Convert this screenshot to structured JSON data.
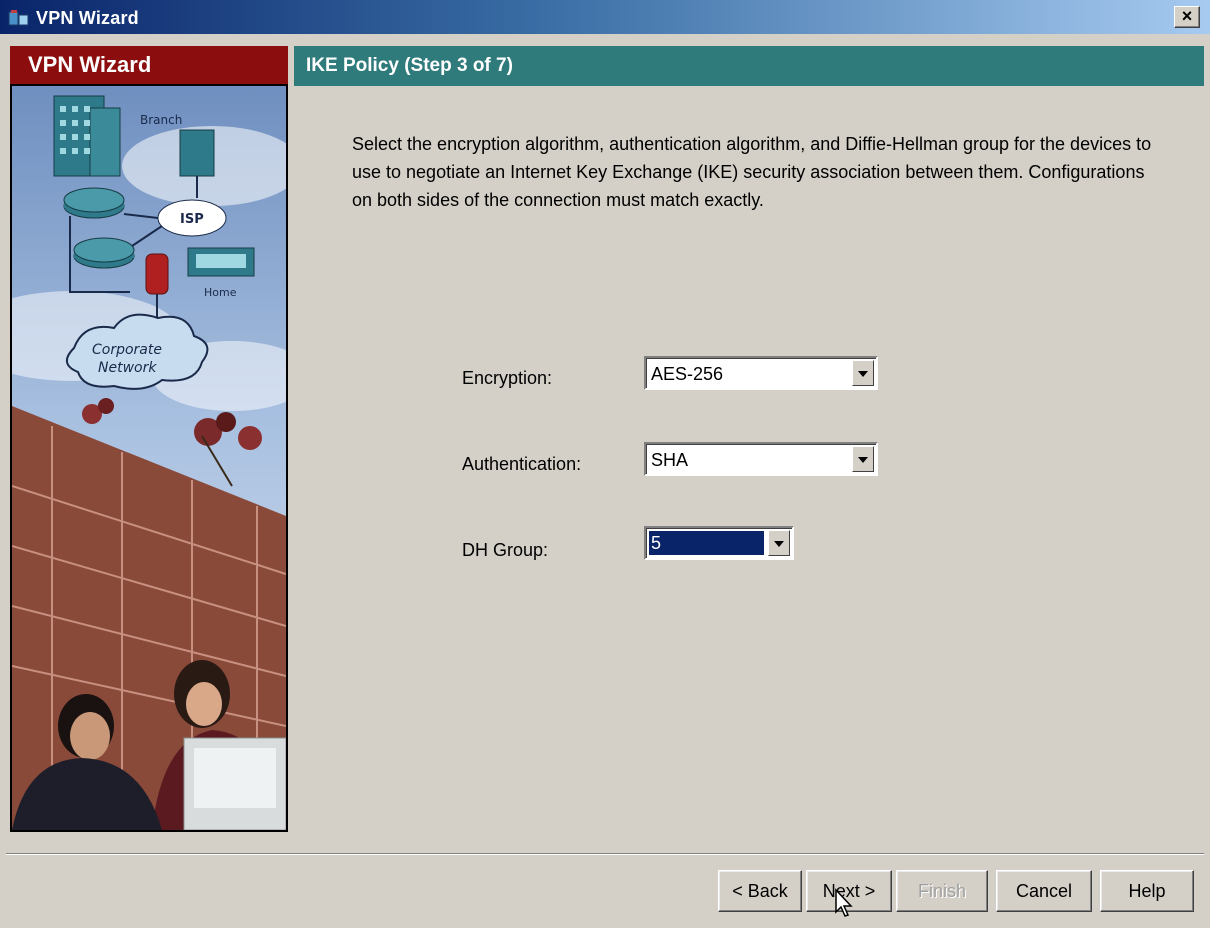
{
  "window": {
    "title": "VPN Wizard",
    "close_label": "×"
  },
  "left_panel": {
    "title": "VPN Wizard",
    "illustration": {
      "branch_label": "Branch",
      "isp_label": "ISP",
      "home_label": "Home",
      "network_label_line1": "Corporate",
      "network_label_line2": "Network"
    }
  },
  "step": {
    "title": "IKE Policy  (Step 3 of 7)",
    "description": "Select the encryption algorithm, authentication algorithm, and Diffie-Hellman group for the devices to use to negotiate an Internet Key Exchange (IKE) security association between them.  Configurations on both sides of the connection must match exactly."
  },
  "fields": {
    "encryption": {
      "label": "Encryption:",
      "value": "AES-256"
    },
    "authentication": {
      "label": "Authentication:",
      "value": "SHA"
    },
    "dh_group": {
      "label": "DH Group:",
      "value": "5"
    }
  },
  "buttons": {
    "back": "< Back",
    "next": "Next >",
    "finish": "Finish",
    "cancel": "Cancel",
    "help": "Help"
  },
  "colors": {
    "title_bar": "#0a246a",
    "left_header": "#8b0d0d",
    "step_header": "#2f7b7b",
    "selection": "#0a246a"
  },
  "icons": [
    "vpn-wizard-app-icon",
    "close-icon",
    "dropdown-arrow-icon",
    "mouse-cursor-icon"
  ]
}
